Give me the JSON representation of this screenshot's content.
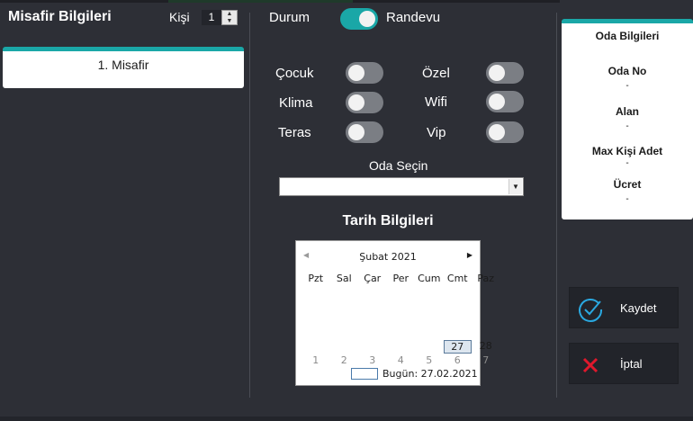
{
  "header": {
    "title": "Misafir Bilgileri",
    "kisi_label": "Kişi",
    "kisi_value": "1",
    "durum_label": "Durum",
    "randevu_label": "Randevu"
  },
  "guests": [
    {
      "label": "1. Misafir"
    }
  ],
  "options": {
    "cocuk": "Çocuk",
    "ozel": "Özel",
    "klima": "Klima",
    "wifi": "Wifi",
    "teras": "Teras",
    "vip": "Vip"
  },
  "room_select": {
    "label": "Oda Seçin",
    "value": ""
  },
  "date_section": {
    "title": "Tarih Bilgileri",
    "calendar": {
      "month": "Şubat 2021",
      "weekdays": [
        "Pzt",
        "Sal",
        "Çar",
        "Per",
        "Cum",
        "Cmt",
        "Paz"
      ],
      "last_row": [
        "",
        "",
        "",
        "",
        "",
        "27",
        "28"
      ],
      "next_row": [
        "1",
        "2",
        "3",
        "4",
        "5",
        "6",
        "7"
      ],
      "today_text": "Bugün: 27.02.2021"
    }
  },
  "room_info": {
    "title": "Oda Bilgileri",
    "oda_no_label": "Oda No",
    "oda_no_value": "-",
    "alan_label": "Alan",
    "alan_value": "-",
    "max_label": "Max Kişi Adet",
    "max_value": "-",
    "ucret_label": "Ücret",
    "ucret_value": "-"
  },
  "actions": {
    "save": "Kaydet",
    "cancel": "İptal"
  },
  "colors": {
    "background": "#2d2f36",
    "accent": "#1aa7a7",
    "toggle_off": "#7b7e84",
    "cancel_icon": "#e0182c",
    "save_icon": "#2aa8e0"
  }
}
